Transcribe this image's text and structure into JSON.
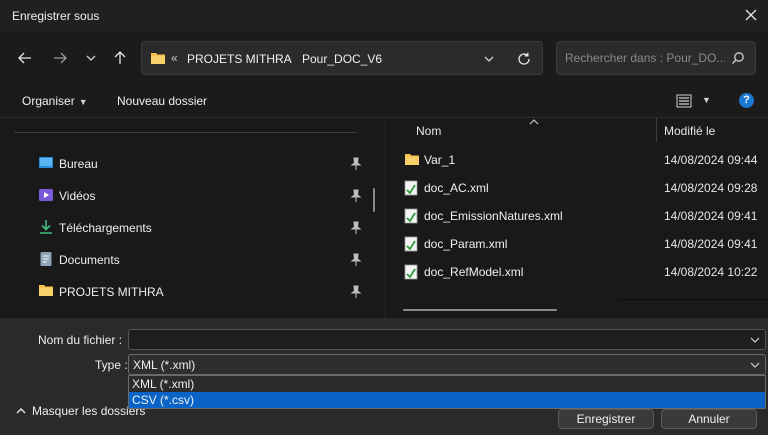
{
  "window": {
    "title": "Enregistrer sous"
  },
  "address": {
    "overflow": "«",
    "crumbs": [
      "PROJETS MITHRA",
      "Pour_DOC_V6"
    ],
    "separator": "›"
  },
  "search": {
    "placeholder": "Rechercher dans : Pour_DO..."
  },
  "toolbar": {
    "organize": "Organiser",
    "new_folder": "Nouveau dossier",
    "help": "?"
  },
  "sidebar": {
    "items": [
      {
        "label": "Bureau",
        "icon": "desktop-icon"
      },
      {
        "label": "Vidéos",
        "icon": "videos-icon"
      },
      {
        "label": "Téléchargements",
        "icon": "download-icon"
      },
      {
        "label": "Documents",
        "icon": "documents-icon"
      },
      {
        "label": "PROJETS MITHRA",
        "icon": "folder-icon"
      }
    ]
  },
  "columns": {
    "name": "Nom",
    "modified": "Modifié le"
  },
  "files": [
    {
      "name": "Var_1",
      "date": "14/08/2024 09:44",
      "type": "folder"
    },
    {
      "name": "doc_AC.xml",
      "date": "14/08/2024 09:28",
      "type": "xml"
    },
    {
      "name": "doc_EmissionNatures.xml",
      "date": "14/08/2024 09:41",
      "type": "xml"
    },
    {
      "name": "doc_Param.xml",
      "date": "14/08/2024 09:41",
      "type": "xml"
    },
    {
      "name": "doc_RefModel.xml",
      "date": "14/08/2024 10:22",
      "type": "xml"
    }
  ],
  "footer": {
    "filename_label": "Nom du fichier :",
    "filename_value": "",
    "type_label": "Type :",
    "type_value": "XML (*.xml)",
    "type_options": [
      "XML (*.xml)",
      "CSV (*.csv)"
    ],
    "hide_folders": "Masquer les dossiers",
    "save": "Enregistrer",
    "cancel": "Annuler"
  },
  "colors": {
    "accent": "#0a64c8",
    "folder": "#f3c24f",
    "background": "#202020"
  }
}
